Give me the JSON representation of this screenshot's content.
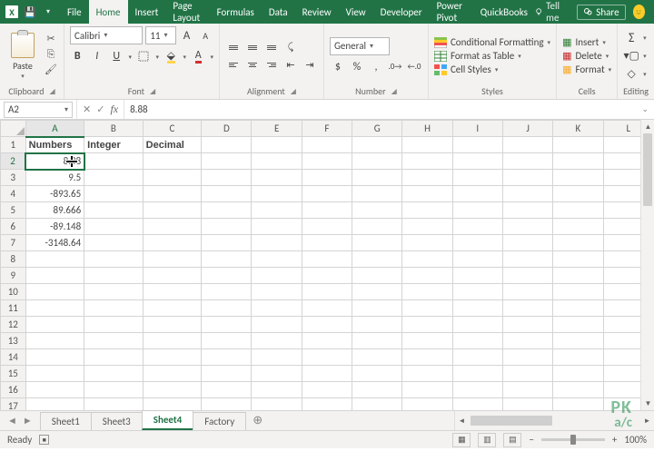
{
  "tabs": {
    "file": "File",
    "home": "Home",
    "insert": "Insert",
    "page_layout": "Page Layout",
    "formulas": "Formulas",
    "data": "Data",
    "review": "Review",
    "view": "View",
    "developer": "Developer",
    "power_pivot": "Power Pivot",
    "quickbooks": "QuickBooks"
  },
  "tellme": "Tell me",
  "share": "Share",
  "ribbon": {
    "clipboard": {
      "label": "Clipboard",
      "paste": "Paste"
    },
    "font": {
      "label": "Font",
      "name": "Calibri",
      "size": "11",
      "increase": "A",
      "decrease": "A",
      "bold": "B",
      "italic": "I",
      "underline": "U"
    },
    "alignment": {
      "label": "Alignment"
    },
    "number": {
      "label": "Number",
      "format": "General",
      "currency": "$",
      "percent": "%",
      "comma": ","
    },
    "styles": {
      "label": "Styles",
      "cond": "Conditional Formatting",
      "table": "Format as Table",
      "cell": "Cell Styles"
    },
    "cells": {
      "label": "Cells",
      "insert": "Insert",
      "delete": "Delete",
      "format": "Format"
    },
    "editing": {
      "label": "Editing"
    }
  },
  "namebox": "A2",
  "formula_value": "8.88",
  "columns": [
    "A",
    "B",
    "C",
    "D",
    "E",
    "F",
    "G",
    "H",
    "I",
    "J",
    "K",
    "L"
  ],
  "header_row": {
    "a": "Numbers",
    "b": "Integer",
    "c": "Decimal"
  },
  "data_rows": [
    {
      "n": "2",
      "a": "8.88"
    },
    {
      "n": "3",
      "a": "9.5"
    },
    {
      "n": "4",
      "a": "-893.65"
    },
    {
      "n": "5",
      "a": "89.666"
    },
    {
      "n": "6",
      "a": "-89.148"
    },
    {
      "n": "7",
      "a": "-3148.64"
    }
  ],
  "active_cell_display": "⊕88",
  "empty_rows": [
    "8",
    "9",
    "10",
    "11",
    "12",
    "13",
    "14",
    "15",
    "16",
    "17"
  ],
  "sheets": {
    "s1": "Sheet1",
    "s3": "Sheet3",
    "s4": "Sheet4",
    "factory": "Factory"
  },
  "status": {
    "ready": "Ready",
    "zoom": "100%"
  },
  "watermark": {
    "l1": "PK",
    "l2": "a/c"
  }
}
